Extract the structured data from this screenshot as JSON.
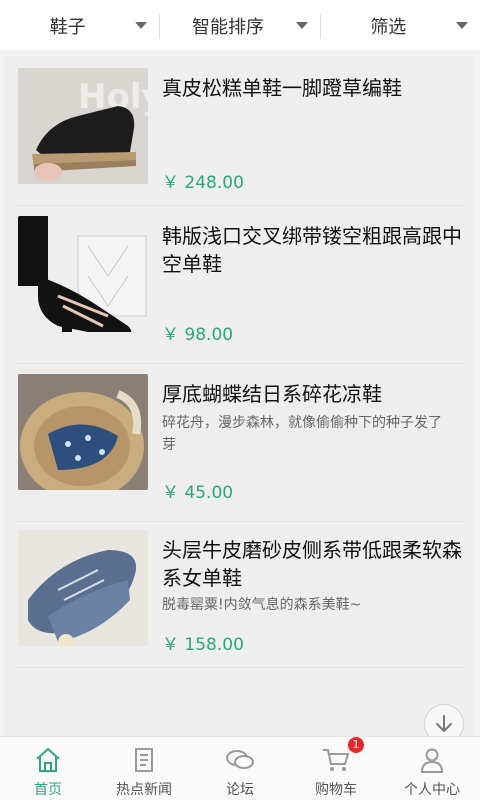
{
  "filters": [
    {
      "label": "鞋子"
    },
    {
      "label": "智能排序"
    },
    {
      "label": "筛选"
    }
  ],
  "products": [
    {
      "title": "真皮松糕单鞋一脚蹬草编鞋",
      "desc": "",
      "price": "￥ 248.00"
    },
    {
      "title": "韩版浅口交叉绑带镂空粗跟高跟中空单鞋",
      "desc": "",
      "price": "￥ 98.00"
    },
    {
      "title": "厚底蝴蝶结日系碎花凉鞋",
      "desc": "碎花舟，漫步森林，就像偷偷种下的种子发了芽",
      "price": "￥ 45.00"
    },
    {
      "title": "头层牛皮磨砂皮侧系带低跟柔软森系女单鞋",
      "desc": "脱毒罂粟!内敛气息的森系美鞋~",
      "price": "￥ 158.00"
    }
  ],
  "tabs": [
    {
      "label": "首页",
      "icon": "home-icon"
    },
    {
      "label": "热点新闻",
      "icon": "news-icon"
    },
    {
      "label": "论坛",
      "icon": "forum-icon"
    },
    {
      "label": "购物车",
      "icon": "cart-icon",
      "badge": "1"
    },
    {
      "label": "个人中心",
      "icon": "user-icon"
    }
  ],
  "colors": {
    "accent": "#2aa87a",
    "badge": "#e52828"
  }
}
